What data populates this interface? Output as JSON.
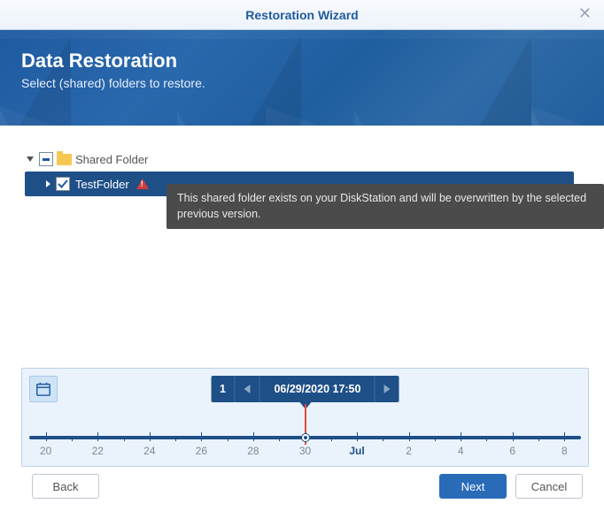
{
  "window": {
    "title": "Restoration Wizard"
  },
  "hero": {
    "heading": "Data Restoration",
    "subheading": "Select (shared) folders to restore."
  },
  "tree": {
    "root_label": "Shared Folder",
    "child_label": "TestFolder"
  },
  "tooltip": {
    "text": "This shared folder exists on your DiskStation and will be overwritten by the selected previous version."
  },
  "timeline": {
    "count": "1",
    "datetime": "06/29/2020 17:50",
    "ticks": [
      "20",
      "22",
      "24",
      "26",
      "28",
      "30",
      "Jul",
      "2",
      "4",
      "6",
      "8"
    ]
  },
  "buttons": {
    "back": "Back",
    "next": "Next",
    "cancel": "Cancel"
  }
}
